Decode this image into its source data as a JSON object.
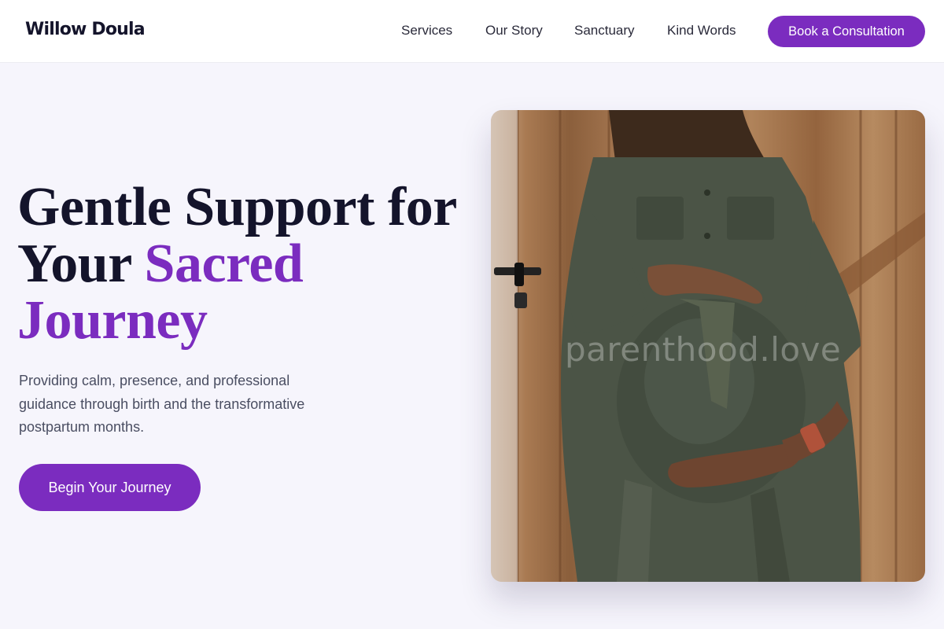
{
  "header": {
    "logo": "Willow Doula",
    "nav": [
      "Services",
      "Our Story",
      "Sanctuary",
      "Kind Words"
    ],
    "cta_label": "Book a Consultation"
  },
  "hero": {
    "title_line1": "Gentle Support for",
    "title_line2_a": "Your ",
    "title_line2_b": "Sacred",
    "title_line3": "Journey",
    "subtitle": "Providing calm, presence, and professional guidance through birth and the transformative postpartum months.",
    "cta_label": "Begin Your Journey"
  },
  "photo": {
    "watermark": "parenthood.love"
  },
  "colors": {
    "accent": "#7b2cbf",
    "heading": "#14142b",
    "body_text": "#4a4e62",
    "background": "#f6f5fc"
  }
}
